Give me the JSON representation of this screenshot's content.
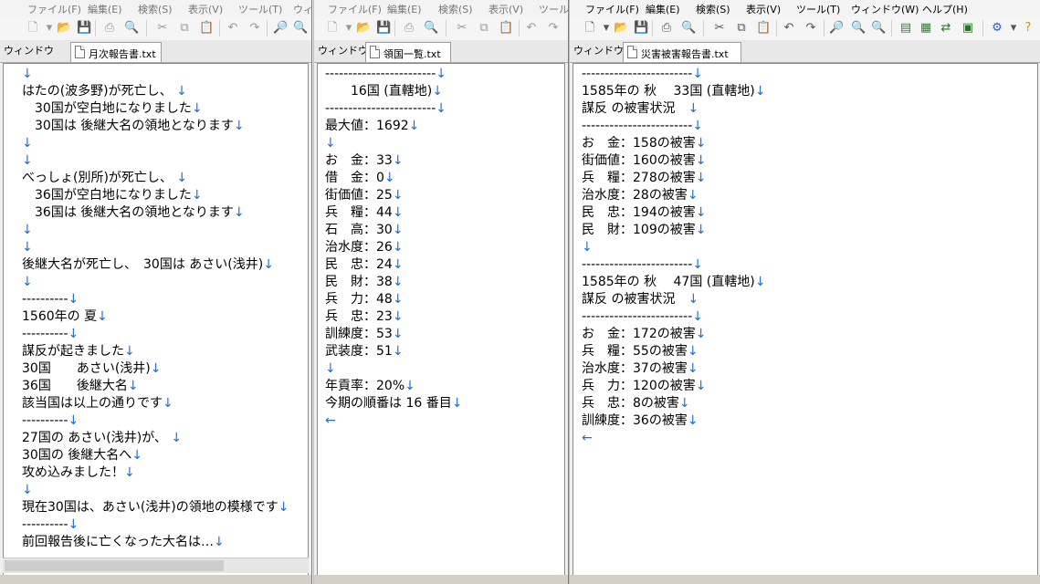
{
  "menu": [
    "ファイル(F)",
    "編集(E)",
    "検索(S)",
    "表示(V)",
    "ツール(T)",
    "ウィンドウ(W)",
    "ヘルプ(H)"
  ],
  "window_tab_label": "ウィンドウ",
  "newline_mark": "↓",
  "eof_mark": "←",
  "windows": [
    {
      "tab_title": "月次報告書.txt",
      "lines": [
        "",
        "はたの(波多野)が死亡し、 ",
        "　30国が空白地になりました",
        "　30国は 後継大名の領地となります",
        "",
        "",
        "べっしょ(別所)が死亡し、 ",
        "　36国が空白地になりました",
        "　36国は 後継大名の領地となります",
        "",
        "",
        "後継大名が死亡し、　30国は あさい(浅井)",
        "",
        "----------",
        "1560年の 夏",
        "----------",
        "謀反が起きました",
        "30国　　あさい(浅井)",
        "36国　　後継大名",
        "該当国は以上の通りです",
        "----------",
        "27国の あさい(浅井)が、 ",
        "30国の 後継大名へ",
        "攻め込みました！",
        "",
        "現在30国は、あさい(浅井)の領地の模様です",
        "----------",
        "前回報告後に亡くなった大名は…"
      ]
    },
    {
      "tab_title": "領国一覧.txt",
      "lines": [
        "------------------------",
        "　　16国 (直轄地)",
        "------------------------",
        "最大値：1692",
        "",
        "お　金：33",
        "借　金：0",
        "街価値：25",
        "兵　糧：44",
        "石　高：30",
        "治水度：26",
        "民　忠：24",
        "民　財：38",
        "兵　力：48",
        "兵　忠：23",
        "訓練度：53",
        "武装度：51",
        "",
        "年貢率：20%",
        "今期の順番は 16 番目",
        ""
      ]
    },
    {
      "tab_title": "災害被害報告書.txt",
      "lines": [
        "------------------------",
        "1585年の 秋　 33国 (直轄地)",
        "謀反 の被害状況　",
        "------------------------",
        "お　金：158の被害",
        "街価値：160の被害",
        "兵　糧：278の被害",
        "治水度：28の被害",
        "民　忠：194の被害",
        "民　財：109の被害",
        "",
        "------------------------",
        "1585年の 秋　 47国 (直轄地)",
        "謀反 の被害状況　",
        "------------------------",
        "お　金：172の被害",
        "兵　糧：55の被害",
        "治水度：37の被害",
        "兵　力：120の被害",
        "兵　忠：8の被害",
        "訓練度：36の被害",
        ""
      ]
    }
  ]
}
